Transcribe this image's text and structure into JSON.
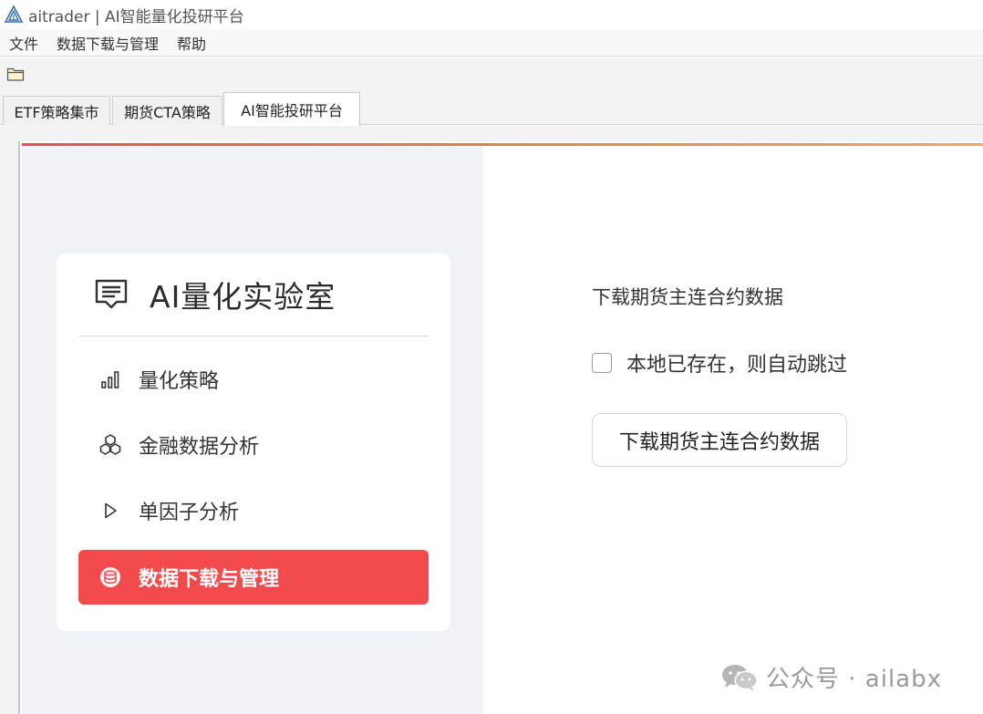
{
  "window": {
    "title": "aitrader | AI智能量化投研平台"
  },
  "menubar": {
    "items": [
      "文件",
      "数据下载与管理",
      "帮助"
    ]
  },
  "tabs": [
    {
      "label": "ETF策略集市",
      "active": false
    },
    {
      "label": "期货CTA策略",
      "active": false
    },
    {
      "label": "AI智能投研平台",
      "active": true
    }
  ],
  "sidebar": {
    "title": "AI量化实验室",
    "title_icon": "message-square-icon",
    "items": [
      {
        "label": "量化策略",
        "icon": "bar-chart-icon",
        "active": false
      },
      {
        "label": "金融数据分析",
        "icon": "blocks-icon",
        "active": false
      },
      {
        "label": "单因子分析",
        "icon": "play-triangle-icon",
        "active": false
      },
      {
        "label": "数据下载与管理",
        "icon": "database-icon",
        "active": true
      }
    ]
  },
  "main": {
    "section_title": "下载期货主连合约数据",
    "skip_existing_label": "本地已存在，则自动跳过",
    "skip_existing_checked": false,
    "download_button_label": "下载期货主连合约数据"
  },
  "watermark": {
    "text": "公众号 · ailabx"
  },
  "colors": {
    "accent_red": "#f24a4d",
    "accent_orange": "#f7a35c",
    "sidebar_bg": "#f0f2f6"
  }
}
